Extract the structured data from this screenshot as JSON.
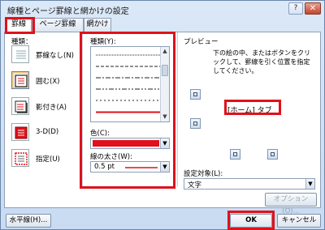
{
  "window": {
    "title": "線種とページ罫線と網かけの設定",
    "help_label": "?",
    "close_label": "✕"
  },
  "tabs": [
    {
      "label": "罫線"
    },
    {
      "label": "ページ罫線"
    },
    {
      "label": "網かけ"
    }
  ],
  "settings": {
    "heading": "種類：",
    "items": [
      {
        "label": "罫線なし(N)",
        "icon": "no-border-icon"
      },
      {
        "label": "囲む(X)",
        "icon": "box-border-icon"
      },
      {
        "label": "影付き(A)",
        "icon": "shadow-border-icon"
      },
      {
        "label": "3-D(D)",
        "icon": "3d-border-icon"
      },
      {
        "label": "指定(U)",
        "icon": "custom-border-icon"
      }
    ]
  },
  "style": {
    "heading": "種類(Y):",
    "color_label": "色(C):",
    "width_label": "線の太さ(W):",
    "width_value": "0.5 pt",
    "accent_color": "#e0111a"
  },
  "preview": {
    "heading": "プレビュー",
    "instruction": "下の絵の中、またはボタンをクリックして、罫線を引く位置を指定してください。",
    "annotation": "[ホーム] タブ",
    "apply_label": "設定対象(L):",
    "apply_value": "文字",
    "options_label": "オプション(O)..."
  },
  "footer": {
    "horizontal_line": "水平線(H)...",
    "ok": "OK",
    "cancel": "キャンセル"
  }
}
